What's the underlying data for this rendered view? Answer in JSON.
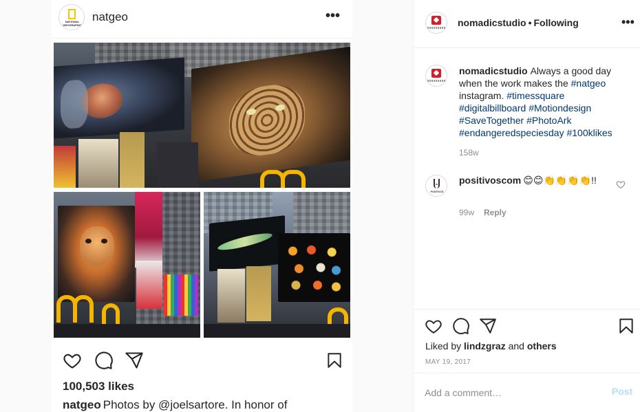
{
  "embedded_post": {
    "username": "natgeo",
    "avatar_text": "NATIONAL GEOGRAPHIC",
    "more": "•••",
    "likes": "100,503 likes",
    "caption_user": "natgeo",
    "caption_text": "Photos by @joelsartore. In honor of"
  },
  "header": {
    "username": "nomadicstudio",
    "separator": "•",
    "follow_status": "Following",
    "more": "•••"
  },
  "caption": {
    "username": "nomadicstudio",
    "segments": [
      {
        "text": "Always a good day when the work makes the ",
        "type": "text"
      },
      {
        "text": "#natgeo",
        "type": "tag"
      },
      {
        "text": " instagram. ",
        "type": "text"
      },
      {
        "text": "#timessquare",
        "type": "tag"
      },
      {
        "text": " ",
        "type": "text"
      },
      {
        "text": "#digitalbillboard",
        "type": "tag"
      },
      {
        "text": " ",
        "type": "text"
      },
      {
        "text": "#Motiondesign",
        "type": "tag"
      },
      {
        "text": " ",
        "type": "text"
      },
      {
        "text": "#SaveTogether",
        "type": "tag"
      },
      {
        "text": " ",
        "type": "text"
      },
      {
        "text": "#PhotoArk",
        "type": "tag"
      },
      {
        "text": " ",
        "type": "text"
      },
      {
        "text": "#endangeredspeciesday",
        "type": "tag"
      },
      {
        "text": " ",
        "type": "text"
      },
      {
        "text": "#100klikes",
        "type": "tag"
      }
    ],
    "time": "158w"
  },
  "comment": {
    "username": "positivoscom",
    "text": "😊😊👏👏👏👏!!",
    "avatar_text": "POSITIVOS",
    "time": "99w",
    "reply_label": "Reply"
  },
  "likes": {
    "prefix": "Liked by",
    "user": "lindzgraz",
    "and": "and",
    "others": "others"
  },
  "date": "MAY 19, 2017",
  "comment_box": {
    "placeholder": "Add a comment…",
    "post_label": "Post"
  },
  "colors": {
    "link": "#00376b",
    "muted": "#8e8e8e",
    "post_disabled": "#b2dffc",
    "brand_red": "#d61d2a",
    "mcd_yellow": "#f4b400"
  }
}
